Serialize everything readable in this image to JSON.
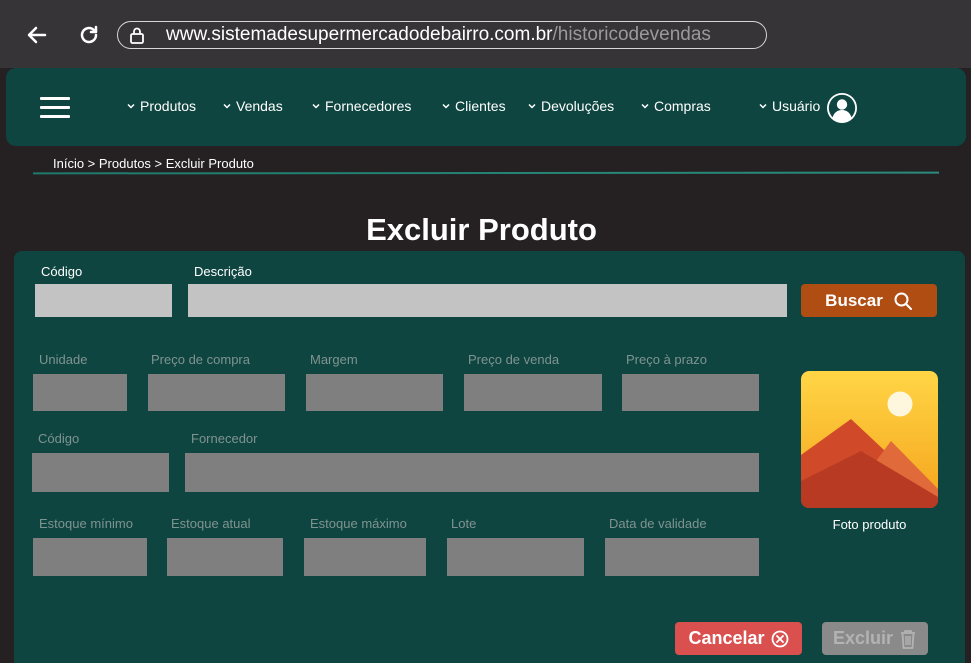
{
  "browser": {
    "url_domain": "www.sistemadesupermercadodebairro.com.br",
    "url_path": "/historicodevendas"
  },
  "nav": {
    "items": [
      "Produtos",
      "Vendas",
      "Fornecedores",
      "Clientes",
      "Devoluções",
      "Compras"
    ],
    "user_label": "Usuário"
  },
  "breadcrumb": "Início > Produtos > Excluir Produto",
  "page_title": "Excluir Produto",
  "search": {
    "codigo_label": "Código",
    "codigo_value": "",
    "descricao_label": "Descrição",
    "descricao_value": "",
    "buscar_label": "Buscar"
  },
  "details": {
    "unidade_label": "Unidade",
    "preco_compra_label": "Preço de compra",
    "margem_label": "Margem",
    "preco_venda_label": "Preço de venda",
    "preco_prazo_label": "Preço à prazo",
    "codigo_label": "Código",
    "fornecedor_label": "Fornecedor",
    "estoque_minimo_label": "Estoque mínimo",
    "estoque_atual_label": "Estoque atual",
    "estoque_maximo_label": "Estoque máximo",
    "lote_label": "Lote",
    "data_validade_label": "Data de validade"
  },
  "photo_label": "Foto produto",
  "actions": {
    "cancel_label": "Cancelar",
    "delete_label": "Excluir"
  },
  "colors": {
    "nav_bg": "#0f4540",
    "page_bg": "#252122",
    "buscar_bg": "#b04d12",
    "cancel_bg": "#d9504f",
    "disabled_bg": "#8a8a8a"
  }
}
